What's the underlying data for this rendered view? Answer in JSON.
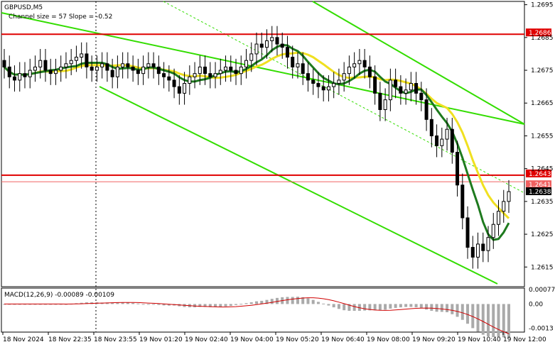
{
  "chart_data": {
    "type": "candlestick",
    "symbol_title": "GBPUSD,M5",
    "channel_info": "Channel size = 57 Slope = -0.52",
    "ylim": [
      1.2609,
      1.2696
    ],
    "y_ticks": [
      "1.2695",
      "1.2685",
      "1.2675",
      "1.2665",
      "1.2655",
      "1.2645",
      "1.2635",
      "1.2625",
      "1.2615"
    ],
    "x_ticks": [
      "18 Nov 2024",
      "18 Nov 22:35",
      "18 Nov 23:55",
      "19 Nov 01:20",
      "19 Nov 02:40",
      "19 Nov 04:00",
      "19 Nov 05:20",
      "19 Nov 06:40",
      "19 Nov 08:00",
      "19 Nov 09:20",
      "19 Nov 10:40",
      "19 Nov 12:00"
    ],
    "horizontal_levels": [
      {
        "value": 1.2686,
        "label": "1.2686",
        "color": "#e00000"
      },
      {
        "value": 1.2643,
        "label": "1.2643",
        "color": "#e00000"
      },
      {
        "value": 1.2641,
        "label": "1.2641",
        "color": "#f06060"
      }
    ],
    "current_price": {
      "value": 1.2638,
      "label": "1.2638"
    },
    "close_series": [
      1.2676,
      1.2673,
      1.2672,
      1.2674,
      1.2673,
      1.2675,
      1.2676,
      1.2678,
      1.2675,
      1.2674,
      1.2675,
      1.2676,
      1.2677,
      1.2678,
      1.2679,
      1.268,
      1.2676,
      1.2675,
      1.2676,
      1.2677,
      1.2675,
      1.2673,
      1.2676,
      1.2677,
      1.2676,
      1.2675,
      1.2674,
      1.2676,
      1.2677,
      1.2676,
      1.2674,
      1.2673,
      1.2672,
      1.267,
      1.2668,
      1.2671,
      1.2673,
      1.2674,
      1.2676,
      1.2674,
      1.2673,
      1.2674,
      1.2675,
      1.2676,
      1.2675,
      1.2674,
      1.2676,
      1.2678,
      1.268,
      1.2683,
      1.2682,
      1.2684,
      1.2685,
      1.2683,
      1.2682,
      1.2679,
      1.2676,
      1.2677,
      1.2674,
      1.2672,
      1.2671,
      1.267,
      1.2669,
      1.267,
      1.2671,
      1.2672,
      1.2674,
      1.2676,
      1.2677,
      1.2678,
      1.2676,
      1.2673,
      1.2668,
      1.2663,
      1.2666,
      1.2672,
      1.267,
      1.2668,
      1.2669,
      1.2671,
      1.2668,
      1.2666,
      1.266,
      1.2655,
      1.2652,
      1.2654,
      1.2657,
      1.265,
      1.264,
      1.263,
      1.2621,
      1.2618,
      1.2622,
      1.262,
      1.2624,
      1.2628,
      1.2632,
      1.2635,
      1.2638
    ],
    "ma_fast_color": "#f0e020",
    "ma_slow_color": "#1e7a1e",
    "channel_color": "#33dd00",
    "macd": {
      "title": "MACD(12,26,9) -0.00089 -0.00109",
      "value": -0.00089,
      "signal": -0.00109,
      "ylim": [
        -0.0015,
        0.00085
      ],
      "y_ticks": [
        "0.00077",
        "0.00",
        "-0.0013"
      ]
    }
  }
}
